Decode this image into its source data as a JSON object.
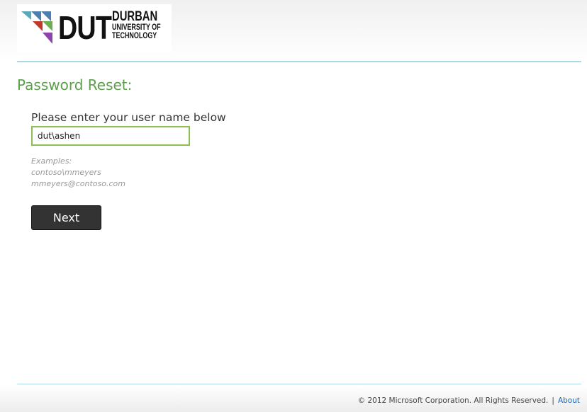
{
  "logo": {
    "abbreviation": "DUT",
    "name_line1": "DURBAN",
    "name_line2": "UNIVERSITY OF",
    "name_line3": "TECHNOLOGY",
    "colors": [
      "#4a7fb0",
      "#6ab04c",
      "#c0392b",
      "#8e44ad"
    ]
  },
  "page": {
    "title": "Password Reset:"
  },
  "form": {
    "prompt": "Please enter your user name below",
    "username_value": "dut\\ashen",
    "examples_label": "Examples:",
    "example1": "contoso\\mmeyers",
    "example2": "mmeyers@contoso.com",
    "next_label": "Next"
  },
  "footer": {
    "copyright": "© 2012 Microsoft Corporation. All Rights Reserved.",
    "separator": "|",
    "about_label": "About"
  },
  "colors": {
    "title_green": "#5c9e4c",
    "input_border": "#8cc152",
    "rule_blue": "#a9d8e6",
    "button_bg": "#333333",
    "link_blue": "#1a64b8"
  }
}
